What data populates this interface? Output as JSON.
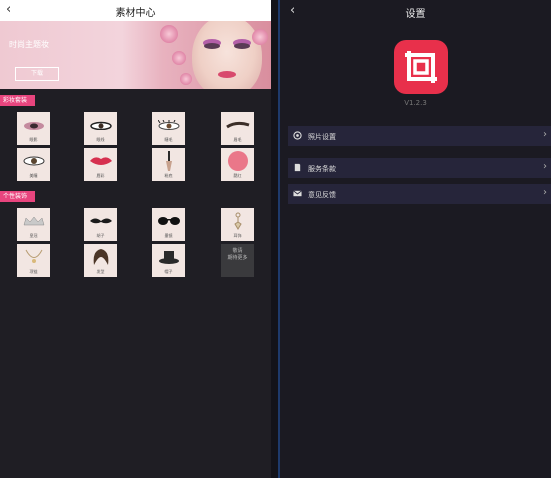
{
  "left": {
    "header": {
      "back_icon": "‹",
      "title": "素材中心"
    },
    "banner": {
      "title": "时尚主题妆",
      "button": "下载"
    },
    "section1": {
      "label": "彩妆套装"
    },
    "section2": {
      "label": "个性装饰"
    },
    "makeup_items": [
      {
        "label": "眼影"
      },
      {
        "label": "眼线"
      },
      {
        "label": "睫毛"
      },
      {
        "label": "眉毛"
      },
      {
        "label": "美瞳"
      },
      {
        "label": "唇彩"
      },
      {
        "label": "粉底"
      },
      {
        "label": "腮红"
      }
    ],
    "accessory_items": [
      {
        "label": "皇冠"
      },
      {
        "label": "胡子"
      },
      {
        "label": "墨镜"
      },
      {
        "label": "耳饰"
      },
      {
        "label": "项链"
      },
      {
        "label": "发型"
      },
      {
        "label": "帽子"
      },
      {
        "label": "敬请\n期待更多"
      }
    ]
  },
  "right": {
    "header": {
      "back_icon": "‹",
      "title": "设置"
    },
    "app_version": "V1.2.3",
    "rows": [
      {
        "label": "照片设置",
        "icon": "camera-icon"
      },
      {
        "label": "服务条款",
        "icon": "document-icon"
      },
      {
        "label": "意见反馈",
        "icon": "mail-icon"
      }
    ],
    "accent_color": "#e8304b"
  }
}
